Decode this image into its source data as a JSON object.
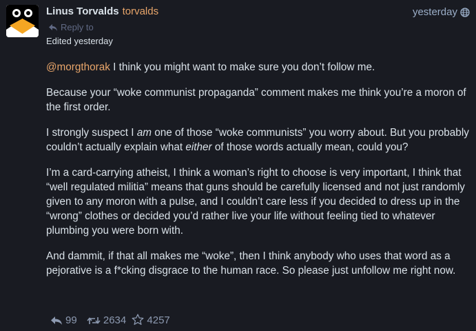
{
  "post": {
    "display_name": "Linus Torvalds",
    "account": "torvalds",
    "timestamp": "yesterday",
    "reply_to": "Reply to",
    "edited": "Edited yesterday",
    "visibility_icon": "globe-icon",
    "avatar_icon": "penguin-avatar"
  },
  "content": {
    "p1": {
      "mention": "@morgthorak",
      "text": " I think you might want to make sure you don’t follow me."
    },
    "p2": "Because your “woke communist propaganda” comment makes me think you’re a moron of the first order.",
    "p3": {
      "a": "I strongly suspect I ",
      "em1": "am",
      "b": " one of those “woke communists” you worry about. But you probably couldn’t actually explain what ",
      "em2": "either",
      "c": " of those words actually mean, could you?"
    },
    "p4": "I’m a card-carrying atheist, I think a woman’s right to choose is very important, I think that “well regulated militia” means that guns should be carefully licensed and not just randomly given to any moron with a pulse, and I couldn’t care less if you decided to dress up in the “wrong” clothes or decided you’d rather live your life without feeling tied to whatever plumbing you were born with.",
    "p5": "And dammit, if that all makes me “woke”, then I think anybody who uses that word as a pejorative is a f*cking disgrace to the human race. So please just unfollow me right now."
  },
  "actions": {
    "replies": "99",
    "boosts": "2634",
    "favourites": "4257"
  },
  "colors": {
    "background": "#191b22",
    "text": "#d9e1e8",
    "accent": "#e8a56a",
    "muted": "#8d9ab1"
  }
}
